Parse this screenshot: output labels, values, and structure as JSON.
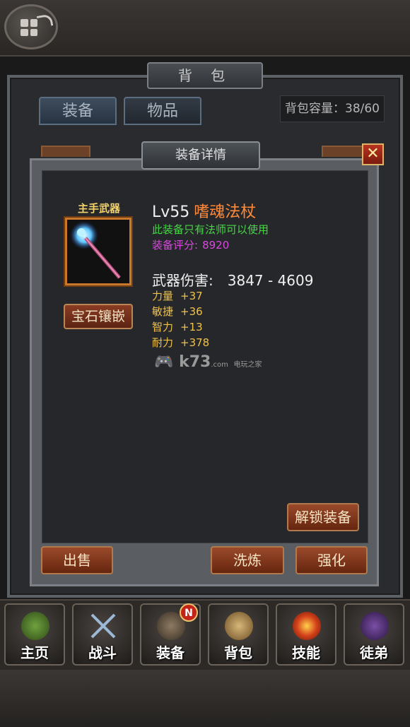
{
  "bag": {
    "title": "背 包",
    "tabs": [
      "装备",
      "物品"
    ],
    "capacity": "背包容量：38/60"
  },
  "detail": {
    "title": "装备详情",
    "close_label": "✕",
    "slot_label": "主手武器",
    "gem_button": "宝石镶嵌",
    "level": "Lv55",
    "name": "嗜魂法杖",
    "restriction": "此装备只有法师可以使用",
    "score_label": "装备评分:",
    "score_value": "8920",
    "damage_label": "武器伤害:",
    "damage_value": "3847  -  4609",
    "stats": [
      {
        "label": "力量",
        "value": "+37"
      },
      {
        "label": "敏捷",
        "value": "+36"
      },
      {
        "label": "智力",
        "value": "+13"
      },
      {
        "label": "耐力",
        "value": "+378"
      }
    ],
    "unlock_button": "解锁装备",
    "sell_button": "出售",
    "refine_button": "洗炼",
    "enhance_button": "强化"
  },
  "watermark": {
    "main": "k73",
    "sub": "电玩之家",
    "domain": ".com"
  },
  "nav": {
    "items": [
      {
        "label": "主页",
        "icon": "goblin-icon"
      },
      {
        "label": "战斗",
        "icon": "crossed-swords-icon"
      },
      {
        "label": "装备",
        "icon": "armor-icon"
      },
      {
        "label": "背包",
        "icon": "bag-icon"
      },
      {
        "label": "技能",
        "icon": "fireball-icon"
      },
      {
        "label": "徒弟",
        "icon": "hooded-figure-icon"
      }
    ],
    "badge": "N"
  },
  "colors": {
    "item_name": "#ff8a3a",
    "restriction": "#46d646",
    "score": "#d948e0",
    "stats": "#f1c24a"
  }
}
